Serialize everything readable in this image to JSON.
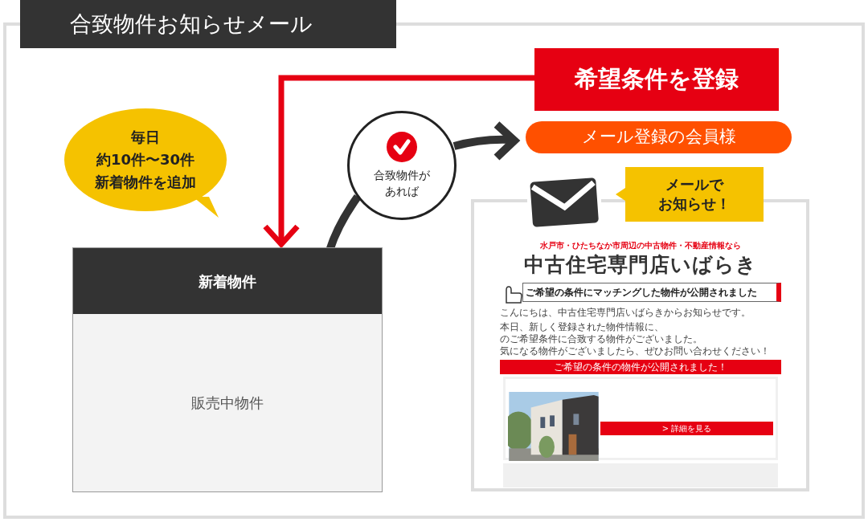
{
  "title": "合致物件お知らせメール",
  "bubble": {
    "lines": [
      "毎日",
      "約10件〜30件",
      "新着物件を追加"
    ]
  },
  "property_panel": {
    "header": "新着物件",
    "body": "販売中物件"
  },
  "match_circle": {
    "lines": [
      "合致物件が",
      "あれば"
    ]
  },
  "register_banner": "希望条件を登録",
  "member_pill": "メール登録の会員様",
  "notify_callout": {
    "lines": [
      "メールで",
      "お知らせ！"
    ]
  },
  "email": {
    "tagline": "水戸市・ひたちなか市周辺の中古物件・不動産情報なら",
    "shop_name": "中古住宅専門店いばらき",
    "banner": "ご希望の条件にマッチングした物件が公開されました",
    "greeting": "こんにちは、中古住宅専門店いばらきからお知らせです。",
    "paragraph_lines": [
      "本日、新しく登録された物件情報に、",
      "のご希望条件に合致する物件がございました。",
      "気になる物件がございましたら、ぜひお問い合わせください！"
    ],
    "section_header": "ご希望の条件の物件が公開されました！",
    "detail_button": "> 詳細を見る"
  }
}
